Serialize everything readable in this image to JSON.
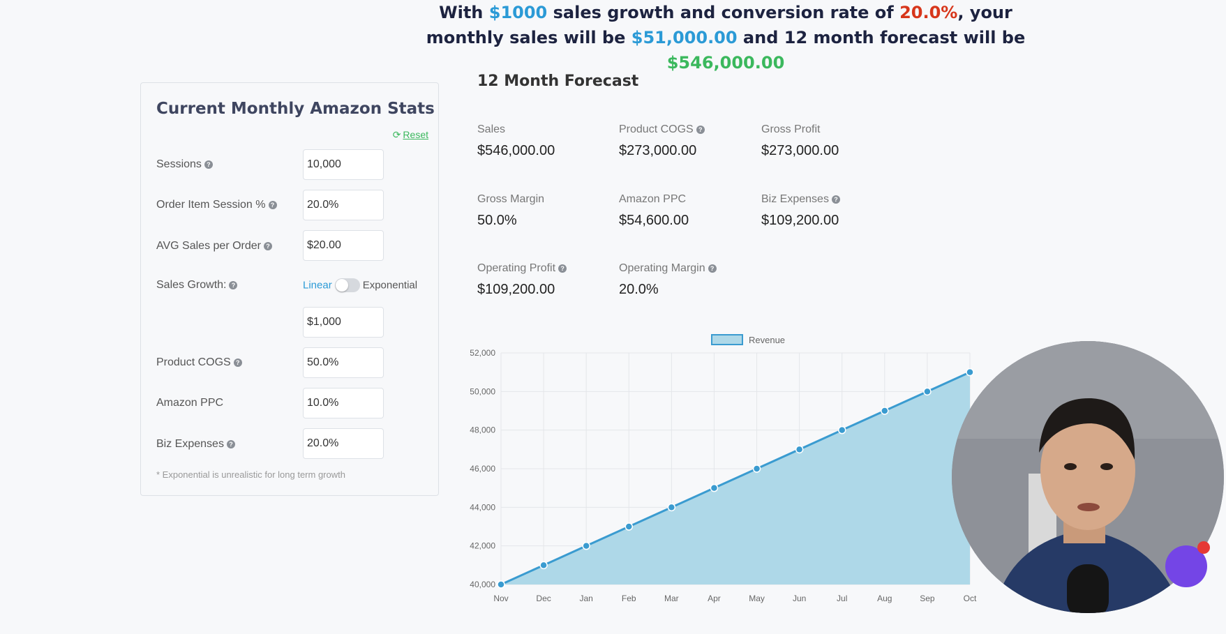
{
  "headline": {
    "p1": "With ",
    "growth": "$1000",
    "p2": " sales growth and conversion rate of ",
    "rate": "20.0%",
    "p3": ", your monthly sales will be ",
    "monthly": "$51,000.00",
    "p4": " and 12 month forecast will be ",
    "forecast": "$546,000.00"
  },
  "stats": {
    "title": "Current Monthly Amazon Stats",
    "reset": "Reset",
    "sessions_label": "Sessions",
    "sessions_value": "10,000",
    "ois_label": "Order Item Session %",
    "ois_value": "20.0%",
    "avg_label": "AVG Sales per Order",
    "avg_value": "$20.00",
    "growth_label": "Sales Growth:",
    "toggle_linear": "Linear",
    "toggle_exponential": "Exponential",
    "growth_value": "$1,000",
    "cogs_label": "Product COGS",
    "cogs_value": "50.0%",
    "ppc_label": "Amazon PPC",
    "ppc_value": "10.0%",
    "biz_label": "Biz Expenses",
    "biz_value": "20.0%",
    "footnote": "* Exponential is unrealistic for long term growth"
  },
  "forecast": {
    "title": "12 Month Forecast",
    "metrics": [
      {
        "label": "Sales",
        "value": "$546,000.00"
      },
      {
        "label": "Product COGS",
        "value": "$273,000.00"
      },
      {
        "label": "Gross Profit",
        "value": "$273,000.00"
      },
      {
        "label": "Gross Margin",
        "value": "50.0%"
      },
      {
        "label": "Amazon PPC",
        "value": "$54,600.00"
      },
      {
        "label": "Biz Expenses",
        "value": "$109,200.00"
      },
      {
        "label": "Operating Profit",
        "value": "$109,200.00"
      },
      {
        "label": "Operating Margin",
        "value": "20.0%"
      }
    ]
  },
  "chart_data": {
    "type": "area",
    "title": "",
    "xlabel": "",
    "ylabel": "",
    "categories": [
      "Nov",
      "Dec",
      "Jan",
      "Feb",
      "Mar",
      "Apr",
      "May",
      "Jun",
      "Jul",
      "Aug",
      "Sep",
      "Oct"
    ],
    "series": [
      {
        "name": "Revenue",
        "values": [
          40000,
          41000,
          42000,
          43000,
          44000,
          45000,
          46000,
          47000,
          48000,
          49000,
          50000,
          51000
        ]
      }
    ],
    "ylim": [
      40000,
      52000
    ],
    "yticks": [
      "40,000",
      "42,000",
      "44,000",
      "46,000",
      "48,000",
      "50,000",
      "52,000"
    ],
    "grid": true,
    "legend": "top-center",
    "colors": {
      "line": "#3a9bd0",
      "fill": "#aed8e8"
    }
  }
}
